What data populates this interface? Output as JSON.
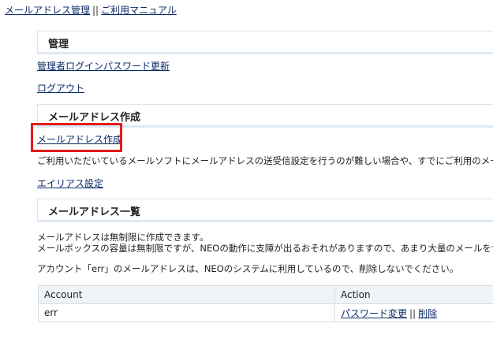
{
  "topnav": {
    "mail_admin": "メールアドレス管理",
    "separator": "||",
    "manual": "ご利用マニュアル"
  },
  "sections": {
    "admin": {
      "title": "管理",
      "change_password_link": "管理者ログインパスワード更新",
      "logout_link": "ログアウト"
    },
    "create": {
      "title": "メールアドレス作成",
      "create_link": "メールアドレス作成",
      "description": "ご利用いただいているメールソフトにメールアドレスの送受信設定を行うのが難しい場合や、すでにご利用のメール",
      "alias_link": "エイリアス設定"
    },
    "list": {
      "title": "メールアドレス一覧",
      "info_line1": "メールアドレスは無制限に作成できます。",
      "info_line2": "メールボックスの容量は無制限ですが、NEOの動作に支障が出るおそれがありますので、あまり大量のメールをサ",
      "warning": "アカウント「err」のメールアドレスは、NEOのシステムに利用しているので、削除しないでください。"
    }
  },
  "table": {
    "headers": {
      "account": "Account",
      "action": "Action"
    },
    "rows": [
      {
        "account": "err",
        "change_password": "パスワード変更",
        "separator": "||",
        "delete": "削除"
      }
    ]
  },
  "colors": {
    "link": "#0b2a66",
    "highlight_border": "#e31b1b",
    "section_border": "#d8e6f3"
  }
}
